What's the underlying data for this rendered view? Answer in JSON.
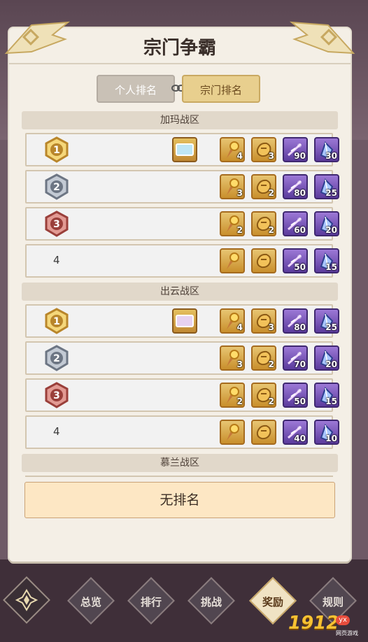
{
  "title": "宗门争霸",
  "tabs": {
    "personal": "个人排名",
    "sect": "宗门排名"
  },
  "zones": [
    {
      "name": "加玛战区",
      "rows": [
        {
          "rank": "1",
          "medal": "gold",
          "has_frame": true,
          "frame_color": "#bfe6f5",
          "items": [
            4,
            3,
            90,
            30
          ]
        },
        {
          "rank": "2",
          "medal": "silver",
          "has_frame": false,
          "items": [
            3,
            2,
            80,
            25
          ]
        },
        {
          "rank": "3",
          "medal": "bronze",
          "has_frame": false,
          "items": [
            2,
            2,
            60,
            20
          ]
        },
        {
          "rank": "4",
          "medal": "none",
          "has_frame": false,
          "items": [
            1,
            1,
            50,
            15
          ]
        }
      ]
    },
    {
      "name": "出云战区",
      "rows": [
        {
          "rank": "1",
          "medal": "gold",
          "has_frame": true,
          "frame_color": "#e7d2f0",
          "items": [
            4,
            3,
            80,
            25
          ]
        },
        {
          "rank": "2",
          "medal": "silver",
          "has_frame": false,
          "items": [
            3,
            2,
            70,
            20
          ]
        },
        {
          "rank": "3",
          "medal": "bronze",
          "has_frame": false,
          "items": [
            2,
            2,
            50,
            15
          ]
        },
        {
          "rank": "4",
          "medal": "none",
          "has_frame": false,
          "items": [
            1,
            1,
            40,
            10
          ]
        }
      ]
    },
    {
      "name": "慕兰战区",
      "rows": []
    }
  ],
  "no_rank": "无排名",
  "nav": [
    "总览",
    "排行",
    "挑战",
    "奖励",
    "规则"
  ],
  "nav_active": "奖励",
  "logo": "1912",
  "logo_badge": "yx",
  "logo_sub": "网页游戏",
  "colors": {
    "accent_gold": "#e8cf8e",
    "panel": "#f4efe6",
    "gold": "#c98f2c",
    "silver": "#8e97a6",
    "bronze": "#b86158"
  }
}
